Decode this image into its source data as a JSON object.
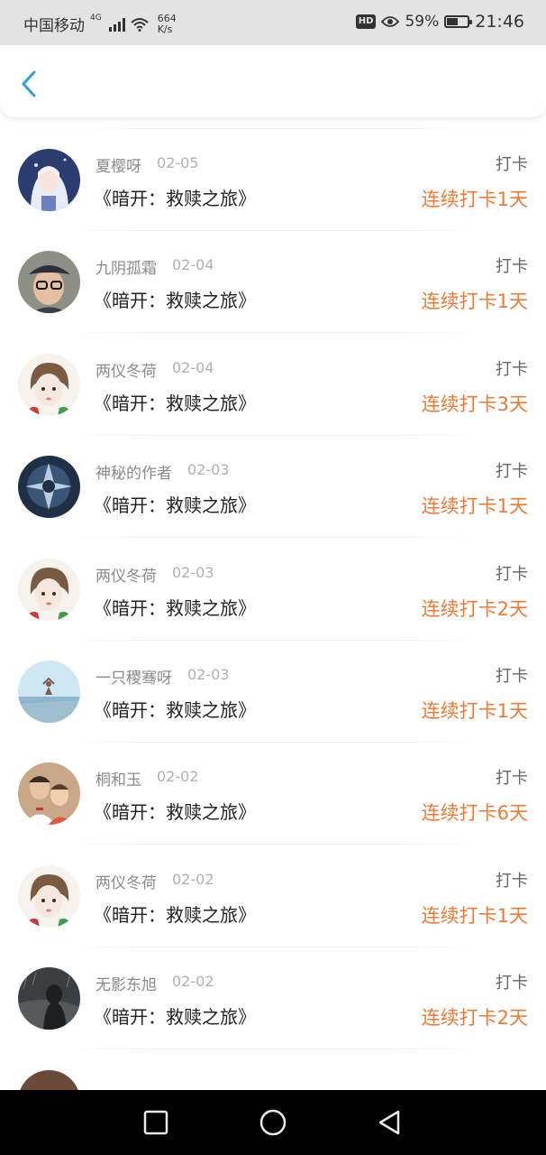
{
  "status_bar": {
    "carrier": "中国移动",
    "network": "4G",
    "speed_value": "664",
    "speed_unit": "K/s",
    "hd_label": "HD",
    "battery_percent": "59%",
    "battery_level": 0.59,
    "time": "21:46"
  },
  "header": {
    "back_icon": "chevron-left-icon",
    "accent_color": "#2f9be8"
  },
  "colors": {
    "streak": "#ee7a33",
    "username": "#8a8a8a",
    "book": "#222222"
  },
  "records": [
    {
      "user": "夏樱呀",
      "date": "02-05",
      "book": "《暗开：救赎之旅》",
      "type": "打卡",
      "streak": "连续打卡1天",
      "avatar": "anime-girl-avatar"
    },
    {
      "user": "九阴孤霜",
      "date": "02-04",
      "book": "《暗开：救赎之旅》",
      "type": "打卡",
      "streak": "连续打卡1天",
      "avatar": "boy-cap-glasses-avatar"
    },
    {
      "user": "两仪冬荷",
      "date": "02-04",
      "book": "《暗开：救赎之旅》",
      "type": "打卡",
      "streak": "连续打卡3天",
      "avatar": "painted-girl-avatar"
    },
    {
      "user": "神秘的作者",
      "date": "02-03",
      "book": "《暗开：救赎之旅》",
      "type": "打卡",
      "streak": "连续打卡1天",
      "avatar": "dark-emblem-avatar"
    },
    {
      "user": "两仪冬荷",
      "date": "02-03",
      "book": "《暗开：救赎之旅》",
      "type": "打卡",
      "streak": "连续打卡2天",
      "avatar": "painted-girl-avatar"
    },
    {
      "user": "一只稷骞呀",
      "date": "02-03",
      "book": "《暗开：救赎之旅》",
      "type": "打卡",
      "streak": "连续打卡1天",
      "avatar": "meditation-sea-avatar"
    },
    {
      "user": "桐和玉",
      "date": "02-02",
      "book": "《暗开：救赎之旅》",
      "type": "打卡",
      "streak": "连续打卡6天",
      "avatar": "family-photo-avatar"
    },
    {
      "user": "两仪冬荷",
      "date": "02-02",
      "book": "《暗开：救赎之旅》",
      "type": "打卡",
      "streak": "连续打卡1天",
      "avatar": "painted-girl-avatar"
    },
    {
      "user": "无影东旭",
      "date": "02-02",
      "book": "《暗开：救赎之旅》",
      "type": "打卡",
      "streak": "连续打卡2天",
      "avatar": "dark-rain-avatar"
    }
  ],
  "nav": {
    "recent_icon": "square-recent-apps-icon",
    "home_icon": "circle-home-icon",
    "back_icon": "triangle-back-icon"
  }
}
